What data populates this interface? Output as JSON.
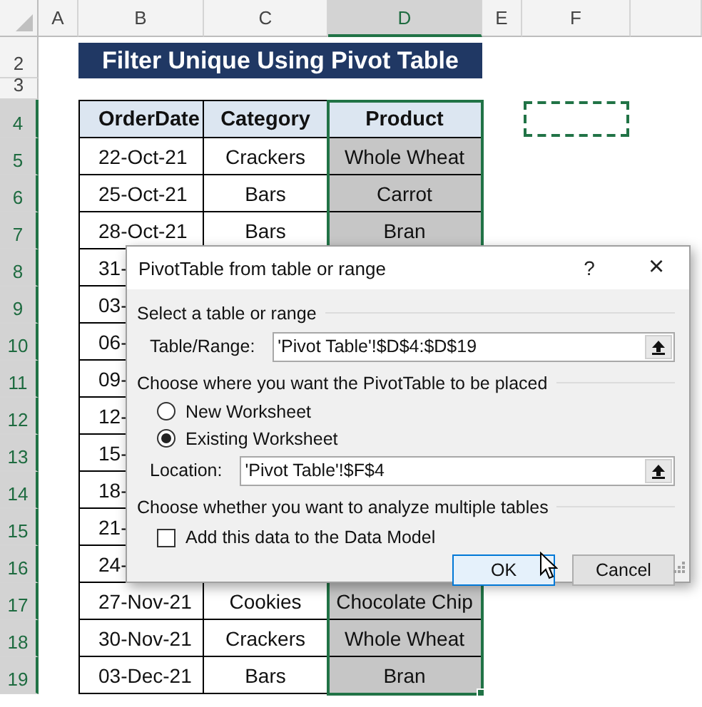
{
  "sheet": {
    "column_headers": [
      {
        "label": "A",
        "selected": false
      },
      {
        "label": "B",
        "selected": false
      },
      {
        "label": "C",
        "selected": false
      },
      {
        "label": "D",
        "selected": true
      },
      {
        "label": "E",
        "selected": false
      },
      {
        "label": "F",
        "selected": false
      }
    ],
    "row_headers": [
      {
        "label": "2",
        "selected": false
      },
      {
        "label": "3",
        "selected": false
      },
      {
        "label": "4",
        "selected": true
      },
      {
        "label": "5",
        "selected": true
      },
      {
        "label": "6",
        "selected": true
      },
      {
        "label": "7",
        "selected": true
      },
      {
        "label": "8",
        "selected": true
      },
      {
        "label": "9",
        "selected": true
      },
      {
        "label": "10",
        "selected": true
      },
      {
        "label": "11",
        "selected": true
      },
      {
        "label": "12",
        "selected": true
      },
      {
        "label": "13",
        "selected": true
      },
      {
        "label": "14",
        "selected": true
      },
      {
        "label": "15",
        "selected": true
      },
      {
        "label": "16",
        "selected": true
      },
      {
        "label": "17",
        "selected": true
      },
      {
        "label": "18",
        "selected": true
      },
      {
        "label": "19",
        "selected": true
      }
    ],
    "title_banner": "Filter Unique Using Pivot Table",
    "table": {
      "columns": [
        "OrderDate",
        "Category",
        "Product"
      ],
      "rows": [
        [
          "22-Oct-21",
          "Crackers",
          "Whole Wheat"
        ],
        [
          "25-Oct-21",
          "Bars",
          "Carrot"
        ],
        [
          "28-Oct-21",
          "Bars",
          "Bran"
        ],
        [
          "31-"
        ],
        [
          "03-"
        ],
        [
          "06-"
        ],
        [
          "09-"
        ],
        [
          "12-"
        ],
        [
          "15-"
        ],
        [
          "18-"
        ],
        [
          "21-"
        ],
        [
          "24-"
        ],
        [
          "27-Nov-21",
          "Cookies",
          "Chocolate Chip"
        ],
        [
          "30-Nov-21",
          "Crackers",
          "Whole Wheat"
        ],
        [
          "03-Dec-21",
          "Bars",
          "Bran"
        ]
      ]
    }
  },
  "dialog": {
    "title": "PivotTable from table or range",
    "help": "?",
    "close": "×",
    "section_1": "Select a table or range",
    "range_field": {
      "label": "Table/Range:",
      "value": "'Pivot Table'!$D$4:$D$19"
    },
    "section_2": "Choose where you want the PivotTable to be placed",
    "placement": [
      {
        "label": "New Worksheet",
        "selected": false
      },
      {
        "label": "Existing Worksheet",
        "selected": true
      }
    ],
    "location_field": {
      "label": "Location:",
      "value": "'Pivot Table'!$F$4"
    },
    "section_3": "Choose whether you want to analyze multiple tables",
    "data_model": {
      "label": "Add this data to the Data Model",
      "checked": false
    },
    "buttons": [
      {
        "label": "OK",
        "default": true
      },
      {
        "label": "Cancel",
        "default": false
      }
    ]
  }
}
